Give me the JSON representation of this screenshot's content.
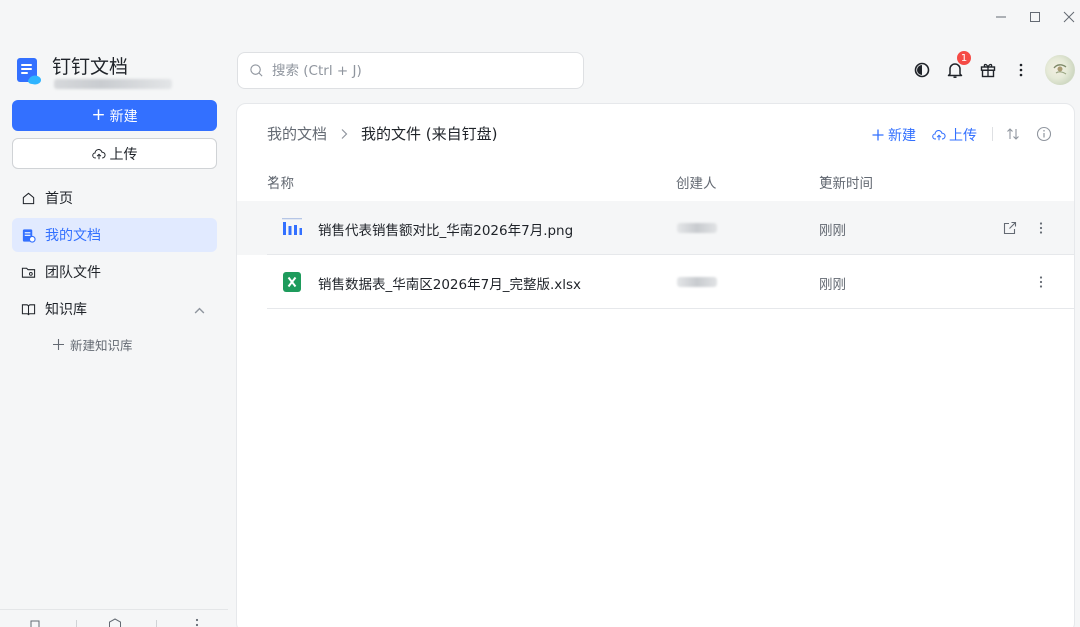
{
  "window": {
    "controls": [
      "minimize",
      "maximize",
      "close"
    ]
  },
  "brand": {
    "title": "钉钉文档",
    "logo_icon": "dingtalk-doc-logo-icon",
    "accent": "#3370ff"
  },
  "sidebar": {
    "new_label": "新建",
    "upload_label": "上传",
    "items": [
      {
        "label": "首页",
        "icon": "home-icon",
        "active": false
      },
      {
        "label": "我的文档",
        "icon": "my-docs-icon",
        "active": true
      },
      {
        "label": "团队文件",
        "icon": "team-folder-icon",
        "active": false
      },
      {
        "label": "知识库",
        "icon": "book-icon",
        "active": false
      }
    ],
    "new_kb_label": "新建知识库"
  },
  "search": {
    "placeholder": "搜索 (Ctrl + J)"
  },
  "topbar": {
    "notification_count": "1",
    "icons": [
      "theme-toggle-icon",
      "bell-icon",
      "gift-icon",
      "more-icon",
      "avatar"
    ]
  },
  "main": {
    "breadcrumb": [
      "我的文档",
      "我的文件 (来自钉盘)"
    ],
    "actions": {
      "new_label": "新建",
      "upload_label": "上传"
    },
    "columns": {
      "name": "名称",
      "creator": "创建人",
      "updated": "更新时间"
    },
    "files": [
      {
        "name": "销售代表销售额对比_华南2026年7月.png",
        "type": "image-chart",
        "time": "刚刚"
      },
      {
        "name": "销售数据表_华南区2026年7月_完整版.xlsx",
        "type": "excel",
        "time": "刚刚"
      }
    ]
  }
}
